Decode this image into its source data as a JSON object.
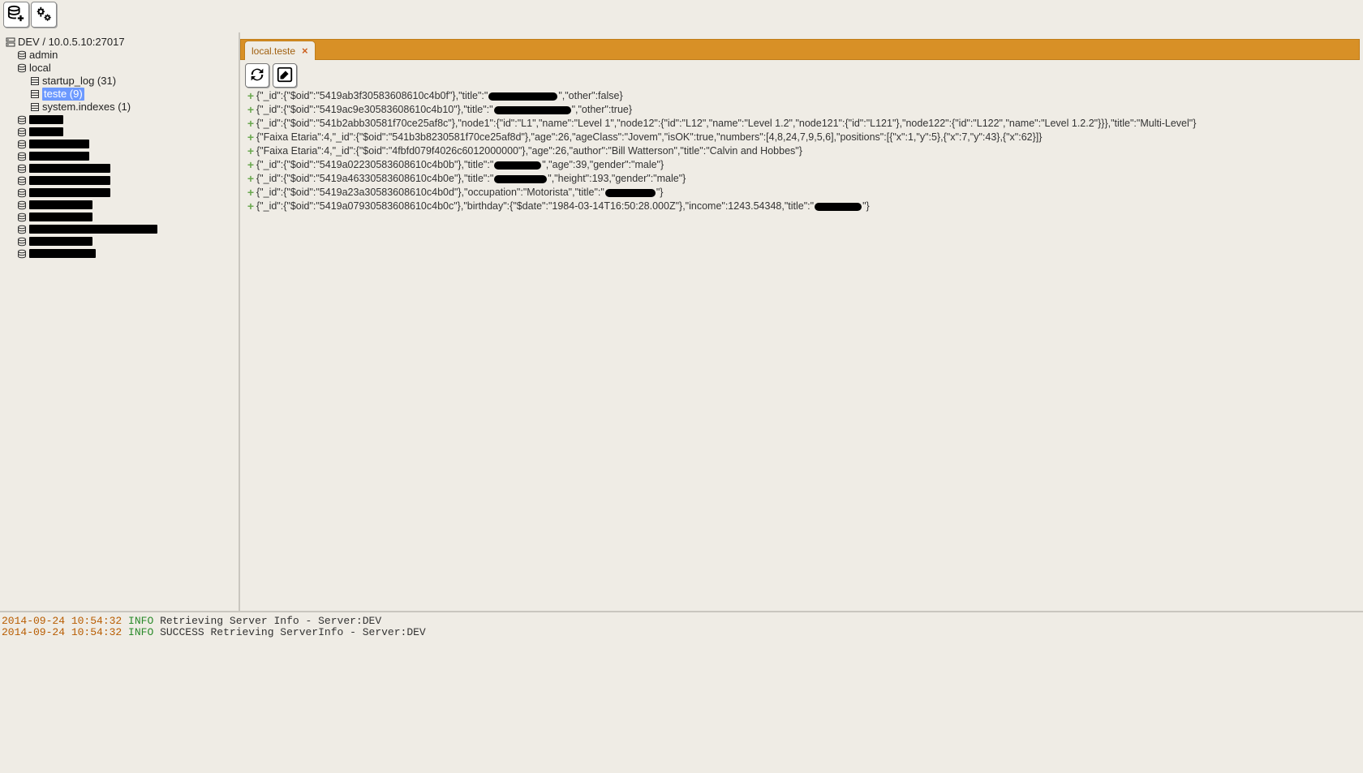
{
  "toolbar": {
    "new_connection_tip": "New Connection",
    "settings_tip": "Settings"
  },
  "tree": {
    "server_label": "DEV / 10.0.5.10:27017",
    "db_admin": "admin",
    "db_local": "local",
    "coll_startup_log": "startup_log (31)",
    "coll_teste": "teste (9)",
    "coll_system_indexes": "system.indexes (1)",
    "redacted_db_widths": [
      42,
      42,
      74,
      74,
      100,
      100,
      100,
      78,
      78,
      158,
      78,
      82
    ]
  },
  "tab": {
    "label": "local.teste",
    "close": "×"
  },
  "doc_toolbar": {
    "refresh_tip": "Refresh",
    "edit_tip": "Edit"
  },
  "docs": [
    {
      "pre": "{\"_id\":{\"$oid\":\"5419ab3f30583608610c4b0f\"},\"title\":\"",
      "blob": 85,
      "post": "\",\"other\":false}"
    },
    {
      "pre": "{\"_id\":{\"$oid\":\"5419ac9e30583608610c4b10\"},\"title\":\"",
      "blob": 95,
      "post": "\",\"other\":true}"
    },
    {
      "pre": "{\"_id\":{\"$oid\":\"541b2abb30581f70ce25af8c\"},\"node1\":{\"id\":\"L1\",\"name\":\"Level 1\",\"node12\":{\"id\":\"L12\",\"name\":\"Level 1.2\",\"node121\":{\"id\":\"L121\"},\"node122\":{\"id\":\"L122\",\"name\":\"Level 1.2.2\"}}},\"title\":\"Multi-Level\"}",
      "blob": 0,
      "post": ""
    },
    {
      "pre": "{\"Faixa Etaria\":4,\"_id\":{\"$oid\":\"541b3b8230581f70ce25af8d\"},\"age\":26,\"ageClass\":\"Jovem\",\"isOK\":true,\"numbers\":[4,8,24,7,9,5,6],\"positions\":[{\"x\":1,\"y\":5},{\"x\":7,\"y\":43},{\"x\":62}]}",
      "blob": 0,
      "post": ""
    },
    {
      "pre": "{\"Faixa Etaria\":4,\"_id\":{\"$oid\":\"4fbfd079f4026c6012000000\"},\"age\":26,\"author\":\"Bill Watterson\",\"title\":\"Calvin and Hobbes\"}",
      "blob": 0,
      "post": ""
    },
    {
      "pre": "{\"_id\":{\"$oid\":\"5419a02230583608610c4b0b\"},\"title\":\"",
      "blob": 58,
      "post": "\",\"age\":39,\"gender\":\"male\"}"
    },
    {
      "pre": "{\"_id\":{\"$oid\":\"5419a46330583608610c4b0e\"},\"title\":\"",
      "blob": 65,
      "post": "\",\"height\":193,\"gender\":\"male\"}"
    },
    {
      "pre": "{\"_id\":{\"$oid\":\"5419a23a30583608610c4b0d\"},\"occupation\":\"Motorista\",\"title\":\"",
      "blob": 62,
      "post": "\"}"
    },
    {
      "pre": "{\"_id\":{\"$oid\":\"5419a07930583608610c4b0c\"},\"birthday\":{\"$date\":\"1984-03-14T16:50:28.000Z\"},\"income\":1243.54348,\"title\":\"",
      "blob": 58,
      "post": "\"}"
    }
  ],
  "log": [
    {
      "ts": "2014-09-24 10:54:32",
      "lvl": "INFO",
      "msg": "Retrieving Server Info - Server:DEV"
    },
    {
      "ts": "2014-09-24 10:54:32",
      "lvl": "INFO",
      "msg": "SUCCESS Retrieving ServerInfo - Server:DEV"
    }
  ]
}
